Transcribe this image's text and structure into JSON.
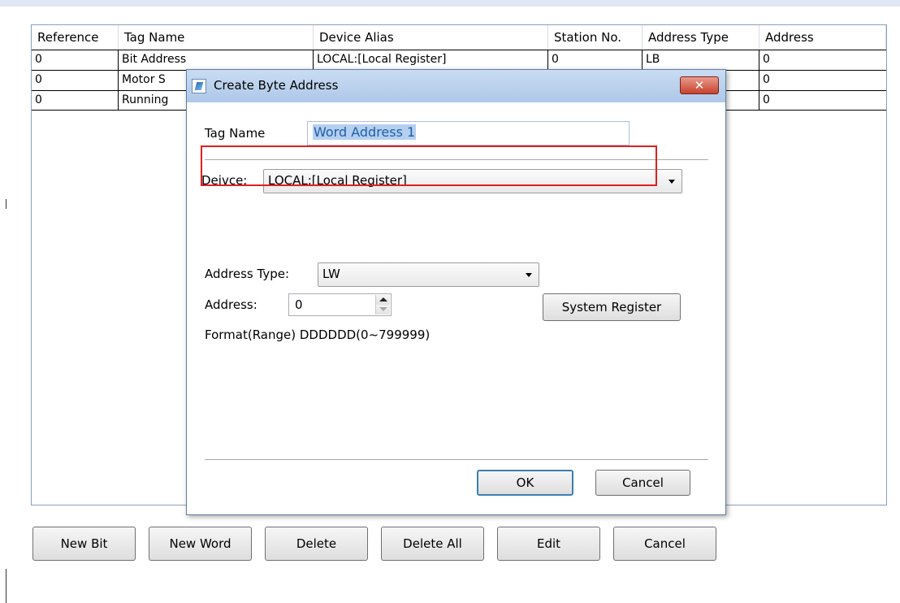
{
  "table": {
    "headers": [
      "Reference",
      "Tag Name",
      "Device Alias",
      "Station No.",
      "Address Type",
      "Address"
    ],
    "rows": [
      [
        "0",
        "Bit Address",
        "LOCAL:[Local Register]",
        "0",
        "LB",
        "0"
      ],
      [
        "0",
        "Motor S",
        "",
        "",
        "",
        "0"
      ],
      [
        "0",
        "Running",
        "",
        "",
        "",
        "0"
      ]
    ]
  },
  "buttons": {
    "new_bit": "New Bit",
    "new_word": "New Word",
    "delete": "Delete",
    "delete_all": "Delete All",
    "edit": "Edit",
    "cancel": "Cancel"
  },
  "dialog": {
    "title": "Create Byte Address",
    "close_glyph": "✕",
    "tag_name_label": "Tag Name",
    "tag_name_value": "Word Address 1",
    "device_label": "Deivce:",
    "device_value": "LOCAL:[Local Register]",
    "address_type_label": "Address Type:",
    "address_type_value": "LW",
    "address_label": "Address:",
    "address_value": "0",
    "system_register_label": "System Register",
    "format_text": "Format(Range) DDDDDD(0~799999)",
    "ok_label": "OK",
    "cancel_label": "Cancel"
  },
  "icons": {
    "dialog": "app-icon",
    "close": "close-icon",
    "combo_arrow": "chevron-down-icon",
    "spin_up": "arrow-up-icon",
    "spin_down": "arrow-down-icon"
  },
  "colors": {
    "titlebar": "#aec8e8",
    "close_button": "#c7432f",
    "highlight_box": "#e02020",
    "selection": "#b5cff0"
  }
}
